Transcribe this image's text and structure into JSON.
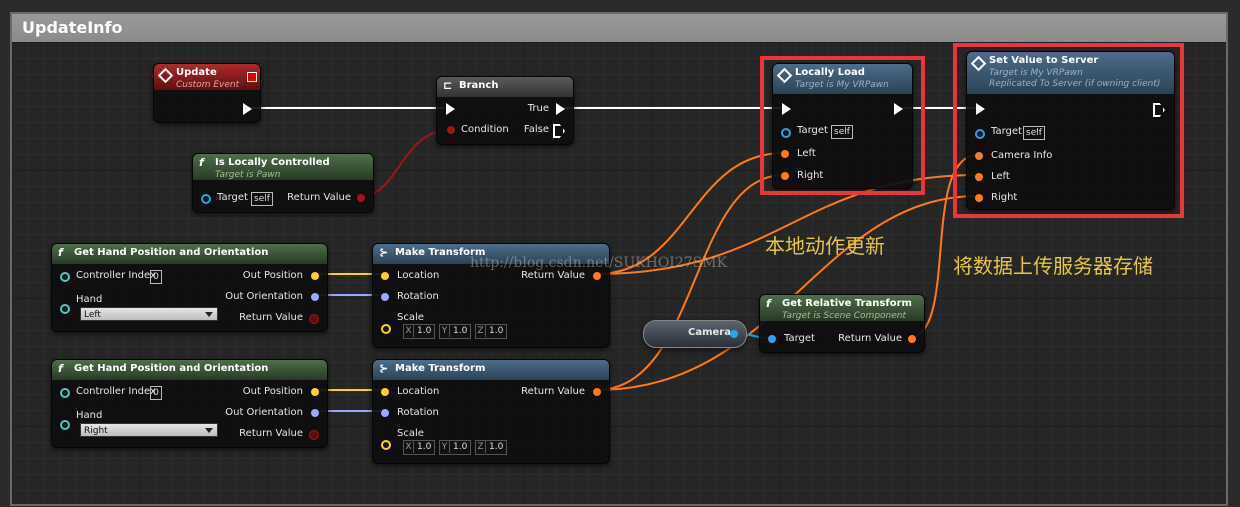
{
  "window": {
    "title": "UpdateInfo"
  },
  "colors": {
    "exec": "#ffffff",
    "bool": "#a31515",
    "object": "#2aa6e6",
    "struct_transform": "#ff7a1a",
    "vector": "#ffd21a",
    "rotator": "#9aa9ff",
    "highlight": "#e8363a",
    "annotation": "#e6c840"
  },
  "nodes": {
    "update": {
      "title": "Update",
      "subtitle": "Custom Event",
      "icon": "event-diamond-icon"
    },
    "branch": {
      "title": "Branch",
      "true_label": "True",
      "false_label": "False",
      "condition_label": "Condition",
      "icon": "branch-icon"
    },
    "is_locally_controlled": {
      "title": "Is Locally Controlled",
      "subtitle": "Target is Pawn",
      "target_label": "Target",
      "target_value": "self",
      "return_label": "Return Value",
      "icon": "function-icon"
    },
    "ghpo1": {
      "title": "Get Hand Position and Orientation",
      "controller_index_label": "Controller Index",
      "controller_index_value": "0",
      "hand_label": "Hand",
      "hand_value": "Left",
      "out_position_label": "Out Position",
      "out_orientation_label": "Out Orientation",
      "return_label": "Return Value",
      "icon": "function-icon"
    },
    "ghpo2": {
      "title": "Get Hand Position and Orientation",
      "controller_index_label": "Controller Index",
      "controller_index_value": "0",
      "hand_label": "Hand",
      "hand_value": "Right",
      "out_position_label": "Out Position",
      "out_orientation_label": "Out Orientation",
      "return_label": "Return Value",
      "icon": "function-icon"
    },
    "mt1": {
      "title": "Make Transform",
      "location_label": "Location",
      "rotation_label": "Rotation",
      "scale_label": "Scale",
      "return_label": "Return Value",
      "scale": {
        "x_label": "X",
        "x": "1.0",
        "y_label": "Y",
        "y": "1.0",
        "z_label": "Z",
        "z": "1.0"
      },
      "icon": "make-struct-icon"
    },
    "mt2": {
      "title": "Make Transform",
      "location_label": "Location",
      "rotation_label": "Rotation",
      "scale_label": "Scale",
      "return_label": "Return Value",
      "scale": {
        "x_label": "X",
        "x": "1.0",
        "y_label": "Y",
        "y": "1.0",
        "z_label": "Z",
        "z": "1.0"
      },
      "icon": "make-struct-icon"
    },
    "locally_load": {
      "title": "Locally Load",
      "subtitle": "Target is My VRPawn",
      "target_label": "Target",
      "target_value": "self",
      "left_label": "Left",
      "right_label": "Right",
      "icon": "event-diamond-icon"
    },
    "set_value": {
      "title": "Set Value to Server",
      "subtitle": "Target is My VRPawn",
      "subtitle2": "Replicated To Server (if owning client)",
      "target_label": "Target",
      "target_value": "self",
      "camera_info_label": "Camera Info",
      "left_label": "Left",
      "right_label": "Right",
      "icon": "event-diamond-icon"
    },
    "camera": {
      "label": "Camera"
    },
    "grt": {
      "title": "Get Relative Transform",
      "subtitle": "Target is Scene Component",
      "target_label": "Target",
      "return_label": "Return Value",
      "icon": "function-icon"
    }
  },
  "annotations": {
    "local_update": "本地动作更新",
    "upload": "将数据上传服务器存储",
    "watermark": "http://blog.csdn.net/SUKHOI27SMK"
  }
}
